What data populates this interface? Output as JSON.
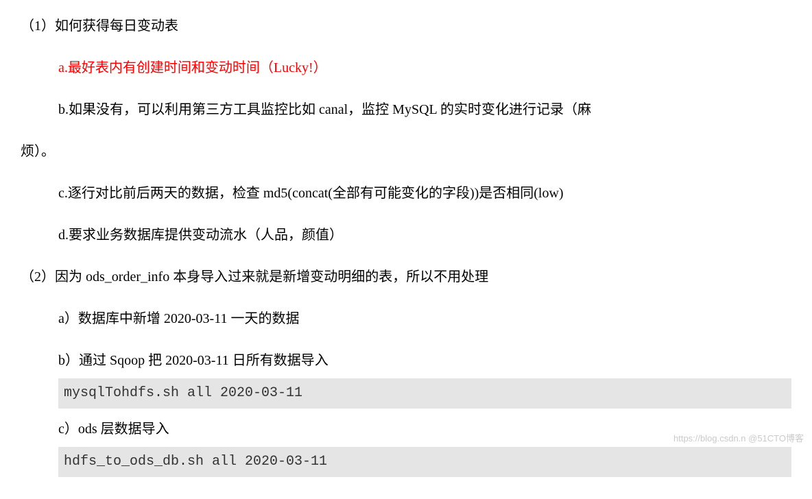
{
  "section1": {
    "title": "（1）如何获得每日变动表",
    "items": {
      "a": "a.最好表内有创建时间和变动时间（Lucky!）",
      "b_part1": "b.如果没有，可以利用第三方工具监控比如 canal，监控 MySQL 的实时变化进行记录（麻",
      "b_part2": "烦）。",
      "c": "c.逐行对比前后两天的数据，检查 md5(concat(全部有可能变化的字段))是否相同(low)",
      "d": "d.要求业务数据库提供变动流水（人品，颜值）"
    }
  },
  "section2": {
    "title": "（2）因为 ods_order_info 本身导入过来就是新增变动明细的表，所以不用处理",
    "items": {
      "a": "a）数据库中新增 2020-03-11 一天的数据",
      "b": "b）通过 Sqoop 把 2020-03-11 日所有数据导入",
      "code1": "mysqlTohdfs.sh all 2020-03-11",
      "c": "c）ods 层数据导入",
      "code2": "hdfs_to_ods_db.sh all 2020-03-11"
    }
  },
  "watermark": "https://blog.csdn.n @51CTO博客"
}
